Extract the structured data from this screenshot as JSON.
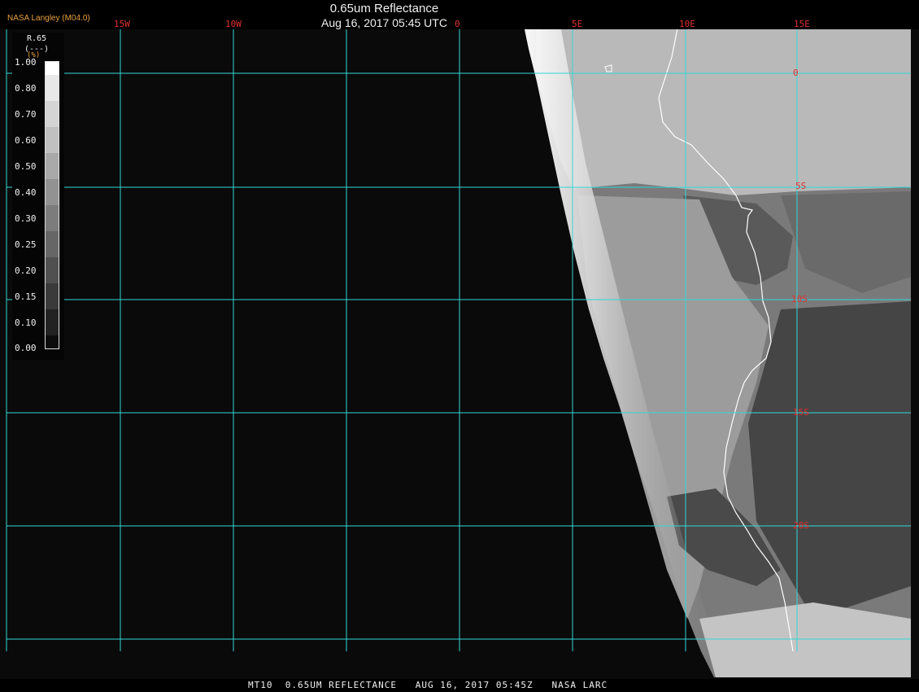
{
  "header": {
    "title": "0.65um Reflectance",
    "datetime": "Aug 16, 2017 05:45 UTC",
    "organization": "NASA Langley (M04.0)"
  },
  "legend": {
    "title": "R.65",
    "units": "(---)",
    "unit_symbol": "(%)",
    "ticks": [
      "1.00",
      "0.80",
      "0.70",
      "0.60",
      "0.50",
      "0.40",
      "0.30",
      "0.25",
      "0.20",
      "0.15",
      "0.10",
      "0.00"
    ]
  },
  "grid": {
    "longitude_labels": [
      "15W",
      "10W",
      "0",
      "5E",
      "10E",
      "15E"
    ],
    "latitude_labels": [
      "0",
      "5S",
      "10S",
      "15S",
      "20S"
    ],
    "color": "#33d6d6"
  },
  "colors": {
    "background": "#000000",
    "ocean": "#0a0a0a",
    "coastline": "#ffffff",
    "lat_label": "#e03030",
    "title_org": "#e8a040"
  },
  "footer": {
    "text": "MT10  0.65UM REFLECTANCE   AUG 16, 2017 05:45Z   NASA LARC"
  }
}
